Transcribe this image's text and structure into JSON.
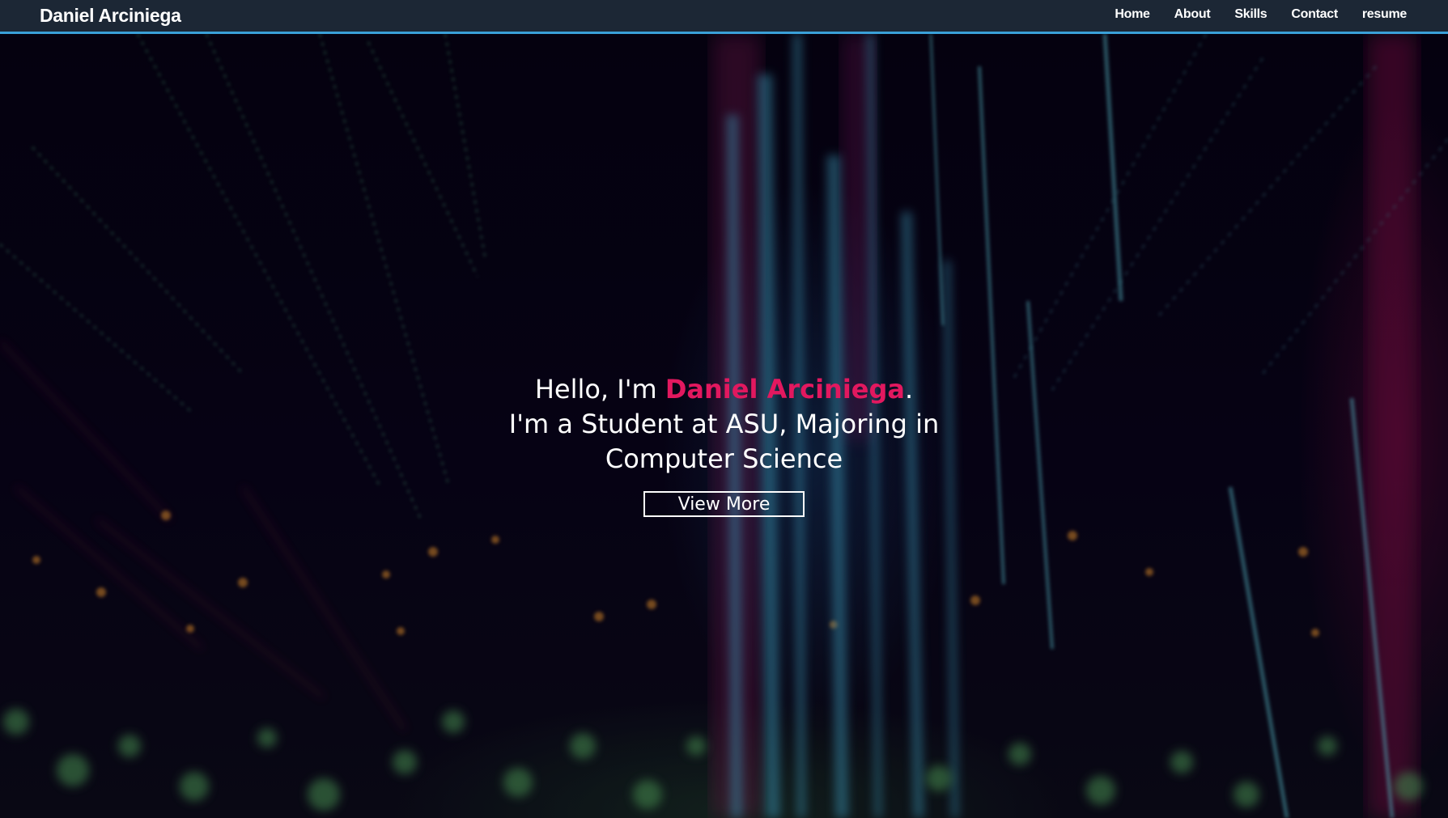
{
  "navbar": {
    "brand": "Daniel Arciniega",
    "links": [
      {
        "label": "Home"
      },
      {
        "label": "About"
      },
      {
        "label": "Skills"
      },
      {
        "label": "Contact"
      },
      {
        "label": "resume"
      }
    ],
    "accent_color": "#3aa0d8",
    "background_color": "#1c2735"
  },
  "hero": {
    "greeting_prefix": "Hello, I'm ",
    "name": "Daniel Arciniega",
    "greeting_suffix": ".",
    "line2": "I'm a Student at ASU, Majoring in",
    "line3": "Computer Science",
    "button_label": "View More",
    "name_color": "#e2185f"
  }
}
